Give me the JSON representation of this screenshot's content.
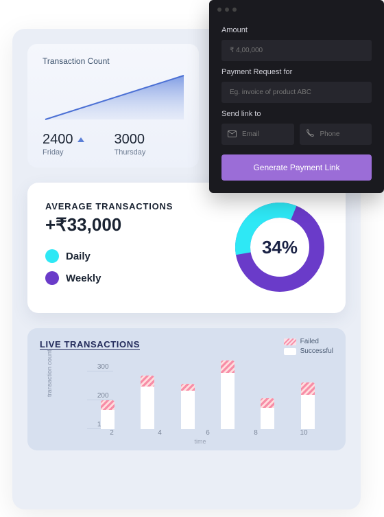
{
  "transaction_count": {
    "title": "Transaction Count",
    "stats": [
      {
        "value": "2400",
        "day": "Friday",
        "trend": "up"
      },
      {
        "value": "3000",
        "day": "Thursday"
      }
    ]
  },
  "payment_form": {
    "amount_label": "Amount",
    "amount_placeholder": "₹ 4,00,000",
    "request_label": "Payment Request for",
    "request_placeholder": "Eg. invoice of product ABC",
    "sendto_label": "Send link to",
    "email_placeholder": "Email",
    "phone_placeholder": "Phone",
    "button": "Generate Payment Link"
  },
  "average": {
    "title": "AVERAGE TRANSACTIONS",
    "value": "+₹33,000",
    "legend": {
      "daily": "Daily",
      "weekly": "Weekly"
    },
    "donut_pct": "34%",
    "colors": {
      "daily": "#2ee8f5",
      "weekly": "#6a3bc9"
    }
  },
  "live": {
    "title": "LIVE TRANSACTIONS",
    "legend": {
      "failed": "Failed",
      "successful": "Successful"
    },
    "ylabel": "transaction count",
    "xlabel": "time",
    "yticks": [
      "300",
      "200",
      "100"
    ],
    "xticks": [
      "2",
      "4",
      "6",
      "8",
      "10"
    ]
  },
  "chart_data": [
    {
      "type": "line",
      "id": "transaction_count_trend",
      "title": "Transaction Count",
      "x": [
        0,
        1
      ],
      "values": [
        2400,
        3000
      ]
    },
    {
      "type": "pie",
      "id": "average_transactions_donut",
      "title": "Average Transactions",
      "series": [
        {
          "name": "Daily",
          "value": 34,
          "color": "#2ee8f5"
        },
        {
          "name": "Weekly",
          "value": 66,
          "color": "#6a3bc9"
        }
      ]
    },
    {
      "type": "bar",
      "id": "live_transactions",
      "title": "Live Transactions",
      "xlabel": "time",
      "ylabel": "transaction count",
      "ylim": [
        0,
        320
      ],
      "categories": [
        "2",
        "4",
        "6",
        "8",
        "10"
      ],
      "series": [
        {
          "name": "Successful",
          "values": [
            90,
            200,
            180,
            260,
            100,
            160
          ]
        },
        {
          "name": "Failed",
          "values": [
            40,
            45,
            30,
            55,
            40,
            55
          ]
        }
      ],
      "note": "6 bars rendered across 5 visible category ticks"
    }
  ]
}
